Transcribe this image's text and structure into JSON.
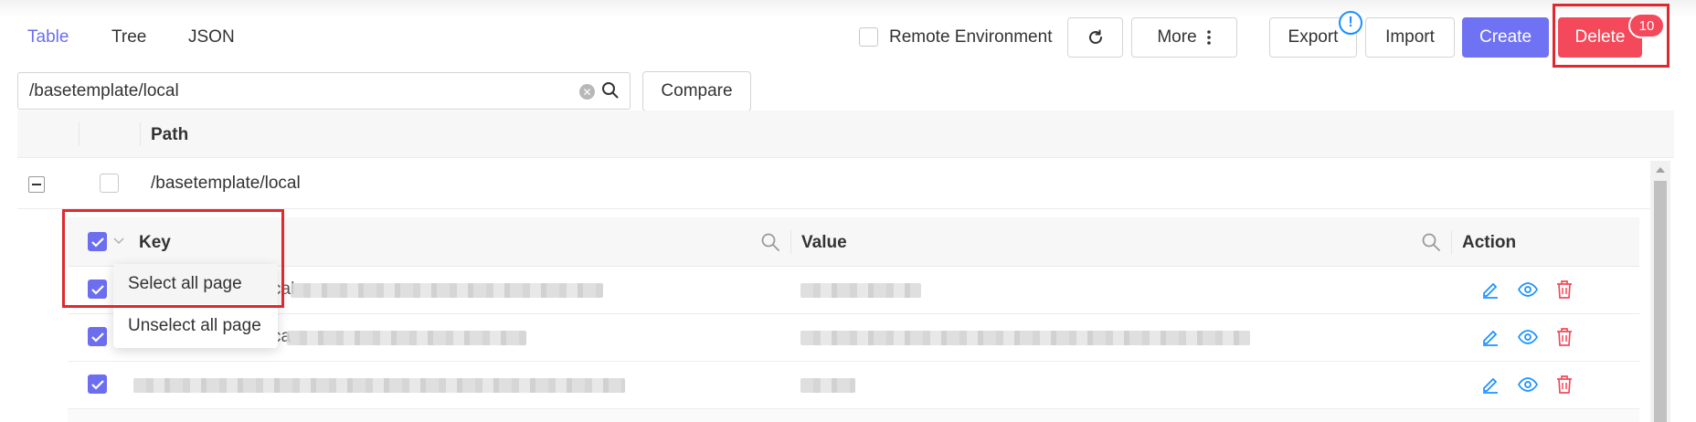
{
  "tabs": [
    {
      "label": "Table",
      "active": true
    },
    {
      "label": "Tree",
      "active": false
    },
    {
      "label": "JSON",
      "active": false
    }
  ],
  "toolbar": {
    "remote_env_label": "Remote Environment",
    "remote_env_checked": false,
    "more_label": "More",
    "export_label": "Export",
    "import_label": "Import",
    "create_label": "Create",
    "delete_label": "Delete",
    "delete_count": "10",
    "export_info_badge": "!"
  },
  "search": {
    "value": "/basetemplate/local",
    "compare_label": "Compare"
  },
  "table": {
    "header_path": "Path",
    "group": {
      "path": "/basetemplate/local",
      "expanded": true,
      "checked": false,
      "subtable": {
        "col_key": "Key",
        "col_value": "Value",
        "col_action": "Action",
        "rows": [
          {
            "key_prefix": "cal",
            "checked": true
          },
          {
            "key_prefix": "ca",
            "checked": true
          },
          {
            "key_prefix": "",
            "checked": true
          }
        ]
      }
    }
  },
  "dropdown": {
    "items": [
      "Select all page",
      "Unselect all page"
    ]
  },
  "colors": {
    "accent": "#6c6ef0",
    "danger": "#f4495a",
    "highlight": "#e0282e",
    "info": "#1890ff"
  }
}
